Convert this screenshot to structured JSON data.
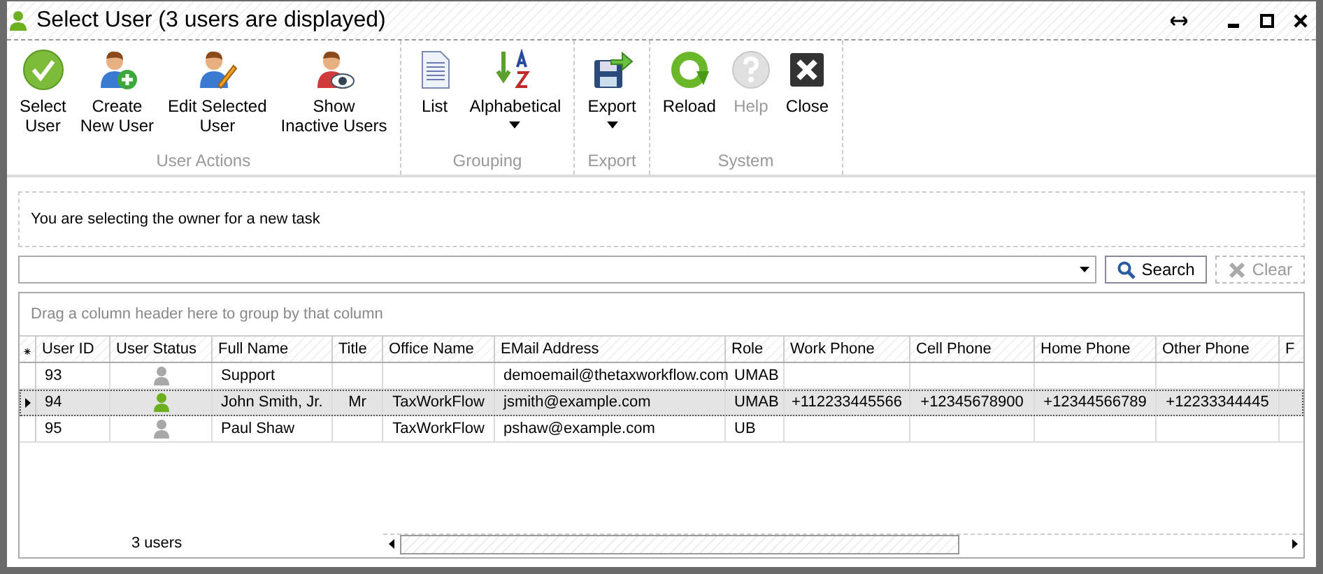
{
  "window": {
    "title": "Select User (3 users are displayed)"
  },
  "toolbar": {
    "groups": [
      {
        "label": "User Actions",
        "buttons": [
          {
            "kind": "select",
            "label": "Select\nUser",
            "disabled": false,
            "dropdown": false
          },
          {
            "kind": "create",
            "label": "Create\nNew User",
            "disabled": false,
            "dropdown": false
          },
          {
            "kind": "edit",
            "label": "Edit Selected\nUser",
            "disabled": false,
            "dropdown": false
          },
          {
            "kind": "inactive",
            "label": "Show\nInactive Users",
            "disabled": false,
            "dropdown": false
          }
        ]
      },
      {
        "label": "Grouping",
        "buttons": [
          {
            "kind": "list",
            "label": "List",
            "disabled": false,
            "dropdown": false
          },
          {
            "kind": "sort",
            "label": "Alphabetical",
            "disabled": false,
            "dropdown": true
          }
        ]
      },
      {
        "label": "Export",
        "buttons": [
          {
            "kind": "export",
            "label": "Export",
            "disabled": false,
            "dropdown": true
          }
        ]
      },
      {
        "label": "System",
        "buttons": [
          {
            "kind": "reload",
            "label": "Reload",
            "disabled": false,
            "dropdown": false
          },
          {
            "kind": "help",
            "label": "Help",
            "disabled": true,
            "dropdown": false
          },
          {
            "kind": "close",
            "label": "Close",
            "disabled": false,
            "dropdown": false
          }
        ]
      }
    ]
  },
  "message": "You are selecting the owner for a new task",
  "search": {
    "search_button": "Search",
    "clear_button": "Clear",
    "clear_disabled": true
  },
  "grid": {
    "group_panel": "Drag a column header here to group by that column",
    "row_indicator_header": "⁕",
    "columns": [
      "User ID",
      "User Status",
      "Full Name",
      "Title",
      "Office Name",
      "EMail Address",
      "Role",
      "Work Phone",
      "Cell Phone",
      "Home Phone",
      "Other Phone",
      "F"
    ],
    "rows": [
      {
        "selected": false,
        "active": false,
        "cells": [
          "93",
          "",
          "Support",
          "",
          "",
          "demoemail@thetaxworkflow.com",
          "UMAB",
          "",
          "",
          "",
          "",
          ""
        ]
      },
      {
        "selected": true,
        "active": true,
        "cells": [
          "94",
          "",
          "John Smith, Jr.",
          "Mr",
          "TaxWorkFlow",
          "jsmith@example.com",
          "UMAB",
          "+112233445566",
          "+12345678900",
          "+12344566789",
          "+12233344445",
          ""
        ]
      },
      {
        "selected": false,
        "active": false,
        "cells": [
          "95",
          "",
          "Paul Shaw",
          "",
          "TaxWorkFlow",
          "pshaw@example.com",
          "UB",
          "",
          "",
          "",
          "",
          ""
        ]
      }
    ],
    "footer": "3 users"
  }
}
